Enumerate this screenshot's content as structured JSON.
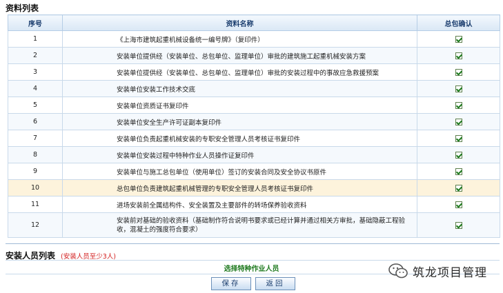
{
  "documents": {
    "title": "资料列表",
    "columns": [
      "序号",
      "资料名称",
      "总包确认"
    ],
    "rows": [
      {
        "no": "1",
        "name": "《上海市建筑起重机械设备统一编号牌》（复印件）",
        "checked": true
      },
      {
        "no": "2",
        "name": "安装单位提供经（安装单位、总包单位、监理单位）审批的建筑施工起重机械安装方案",
        "checked": true
      },
      {
        "no": "3",
        "name": "安装单位提供经（安装单位、总包单位、监理单位）审批的安装过程中的事故应急救援预案",
        "checked": true
      },
      {
        "no": "4",
        "name": "安装单位安装工作技术交底",
        "checked": true
      },
      {
        "no": "5",
        "name": "安装单位资质证书复印件",
        "checked": true
      },
      {
        "no": "6",
        "name": "安装单位安全生产许可证副本复印件",
        "checked": true
      },
      {
        "no": "7",
        "name": "安装单位负责起重机械安装的专职安全管理人员考核证书复印件",
        "checked": true
      },
      {
        "no": "8",
        "name": "安装单位安装过程中特种作业人员操作证复印件",
        "checked": true
      },
      {
        "no": "9",
        "name": "安装单位与施工总包单位（使用单位）签订的安装合同及安全协议书原件",
        "checked": true
      },
      {
        "no": "10",
        "name": "总包单位负责建筑起重机械管理的专职安全管理人员考核证书复印件",
        "checked": true
      },
      {
        "no": "11",
        "name": "进场安装前全属结构件、安全装置及主要部件的转场保养验收资料",
        "checked": true
      },
      {
        "no": "12",
        "name": "安装前对基础的验收资料（基础制作符合说明书要求或已经计算并通过相关方审批，基础隐蔽工程验收，混凝土的强度符合要求）",
        "checked": true
      }
    ]
  },
  "installers": {
    "title": "安装人员列表",
    "note": "(安装人员至少3人)",
    "select_link": "选择特种作业人员"
  },
  "actions": {
    "save_label": "保存",
    "back_label": "返回"
  },
  "watermark": {
    "text": "筑龙项目管理",
    "icon": "wechat-icon"
  },
  "colors": {
    "header_text": "#1a3d6e",
    "header_bg": "#d9e7f5",
    "highlight_row": "#fdf3dc",
    "note_red": "#d21c1c",
    "link_green": "#1f7a1f",
    "check_green": "#1d7a1d"
  }
}
